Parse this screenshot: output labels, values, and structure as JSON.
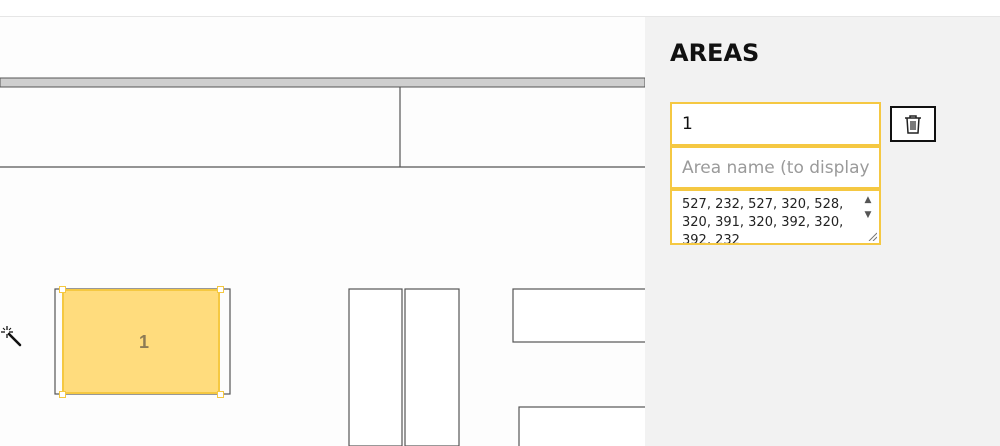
{
  "panel": {
    "title": "AREAS",
    "area": {
      "id_value": "1",
      "name_placeholder": "Area name (to display)",
      "coordinates": "527, 232, 527, 320, 528, 320, 391, 320, 392, 320, 392, 232"
    },
    "delete_icon": "trash-icon"
  },
  "plan": {
    "selected_area_label": "1",
    "tool_icon": "magic-wand-icon",
    "highlight_color": "#ffdc7d",
    "border_color": "#f5c842"
  }
}
